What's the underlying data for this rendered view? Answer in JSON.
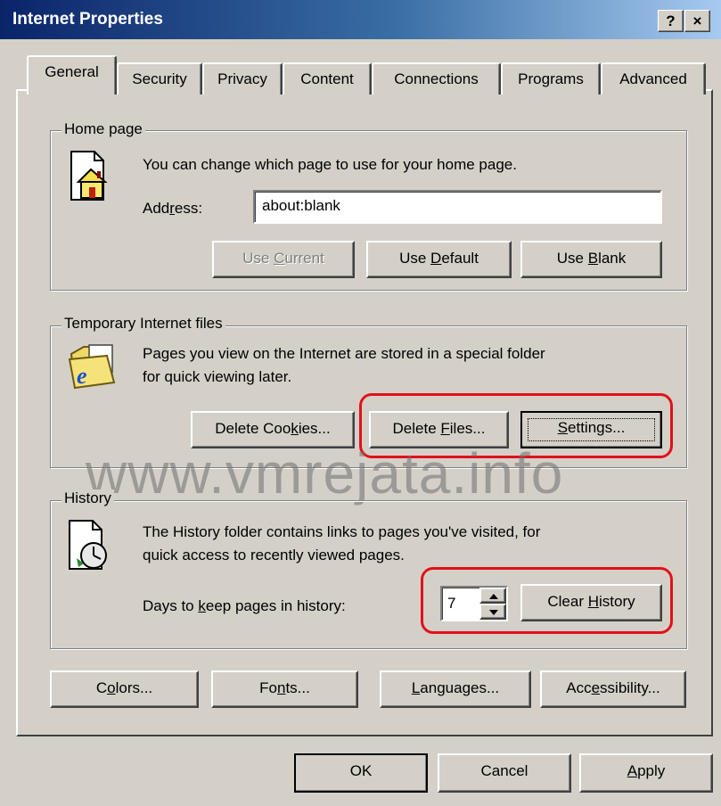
{
  "window": {
    "title": "Internet Properties",
    "help_glyph": "?",
    "close_glyph": "×"
  },
  "tabs": [
    {
      "label": "General"
    },
    {
      "label": "Security"
    },
    {
      "label": "Privacy"
    },
    {
      "label": "Content"
    },
    {
      "label": "Connections"
    },
    {
      "label": "Programs"
    },
    {
      "label": "Advanced"
    }
  ],
  "home_page": {
    "legend": "Home page",
    "description": "You can change which page to use for your home page.",
    "address_label": "Address:",
    "address_value": "about:blank",
    "icon": "home-page-icon",
    "buttons": {
      "use_current": "Use Current",
      "use_default": "Use Default",
      "use_blank": "Use Blank"
    }
  },
  "temp_files": {
    "legend": "Temporary Internet files",
    "description_line1": "Pages you view on the Internet are stored in a special folder",
    "description_line2": "for quick viewing later.",
    "icon": "internet-folder-icon",
    "buttons": {
      "delete_cookies": "Delete Cookies...",
      "delete_files": "Delete Files...",
      "settings": "Settings..."
    }
  },
  "watermark": "www.vmrejata.info",
  "history": {
    "legend": "History",
    "description_line1": "The History folder contains links to pages you've visited, for",
    "description_line2": "quick access to recently viewed pages.",
    "days_label": "Days to keep pages in history:",
    "days_value": "7",
    "icon": "history-clock-icon",
    "clear_button": "Clear History"
  },
  "bottom_buttons": {
    "colors": "Colors...",
    "fonts": "Fonts...",
    "languages": "Languages...",
    "accessibility": "Accessibility..."
  },
  "dialog_buttons": {
    "ok": "OK",
    "cancel": "Cancel",
    "apply": "Apply"
  },
  "colors": {
    "titlebar_start": "#0a246a",
    "titlebar_end": "#a6caf0",
    "face": "#d4d0c8",
    "highlight_mark": "#e3101a"
  }
}
